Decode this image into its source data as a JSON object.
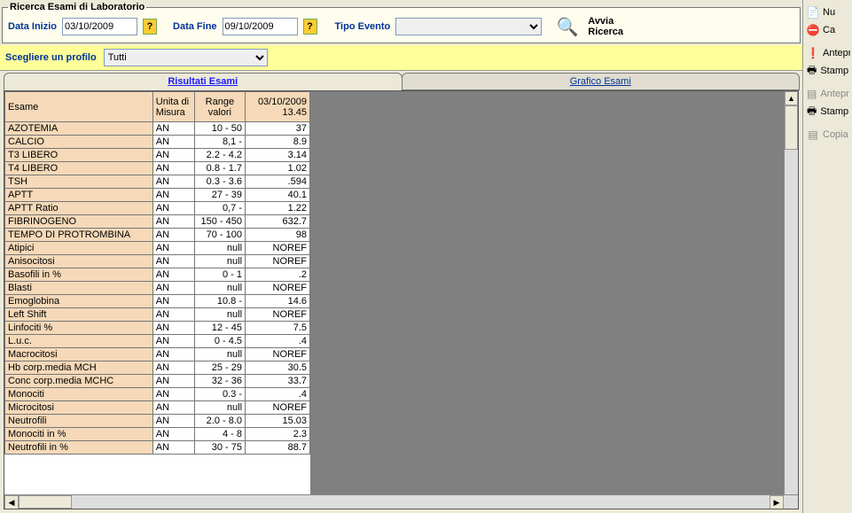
{
  "search": {
    "legend": "Ricerca Esami di Laboratorio",
    "data_inizio_label": "Data Inizio",
    "data_inizio_value": "03/10/2009",
    "help": "?",
    "data_fine_label": "Data Fine",
    "data_fine_value": "09/10/2009",
    "tipo_evento_label": "Tipo Evento",
    "tipo_evento_value": "",
    "avvia": "Avvia",
    "ricerca": "Ricerca"
  },
  "profile": {
    "label": "Scegliere un profilo",
    "value": "Tutti"
  },
  "tabs": {
    "risultati": "Risultati Esami",
    "grafico": "Grafico Esami"
  },
  "grid": {
    "headers": {
      "esame": "Esame",
      "unita": "Unita di\nMisura",
      "range": "Range\nvalori",
      "col1_date": "03/10/2009",
      "col1_time": "13.45"
    },
    "rows": [
      {
        "esame": "AZOTEMIA",
        "unita": "AN",
        "range": "10 - 50",
        "v": "37"
      },
      {
        "esame": "CALCIO",
        "unita": "AN",
        "range": "8,1 -",
        "v": "8.9"
      },
      {
        "esame": "T3 LIBERO",
        "unita": "AN",
        "range": "2.2 - 4.2",
        "v": "3.14"
      },
      {
        "esame": "T4 LIBERO",
        "unita": "AN",
        "range": "0.8 - 1.7",
        "v": "1.02"
      },
      {
        "esame": "TSH",
        "unita": "AN",
        "range": "0.3 - 3.6",
        "v": ".594"
      },
      {
        "esame": "APTT",
        "unita": "AN",
        "range": "27 - 39",
        "v": "40.1"
      },
      {
        "esame": "APTT Ratio",
        "unita": "AN",
        "range": "0,7 -",
        "v": "1.22"
      },
      {
        "esame": "FIBRINOGENO",
        "unita": "AN",
        "range": "150 - 450",
        "v": "632.7"
      },
      {
        "esame": "TEMPO DI PROTROMBINA",
        "unita": "AN",
        "range": "70 - 100",
        "v": "98"
      },
      {
        "esame": "Atipici",
        "unita": "AN",
        "range": "null",
        "v": "NOREF"
      },
      {
        "esame": "Anisocitosi",
        "unita": "AN",
        "range": "null",
        "v": "NOREF"
      },
      {
        "esame": "Basofili in %",
        "unita": "AN",
        "range": "0 - 1",
        "v": ".2"
      },
      {
        "esame": "Blasti",
        "unita": "AN",
        "range": "null",
        "v": "NOREF"
      },
      {
        "esame": "Emoglobina",
        "unita": "AN",
        "range": "10.8 -",
        "v": "14.6"
      },
      {
        "esame": "Left Shift",
        "unita": "AN",
        "range": "null",
        "v": "NOREF"
      },
      {
        "esame": "Linfociti %",
        "unita": "AN",
        "range": "12 - 45",
        "v": "7.5"
      },
      {
        "esame": "L.u.c.",
        "unita": "AN",
        "range": "0 - 4.5",
        "v": ".4"
      },
      {
        "esame": "Macrocitosi",
        "unita": "AN",
        "range": "null",
        "v": "NOREF"
      },
      {
        "esame": "Hb corp.media MCH",
        "unita": "AN",
        "range": "25 - 29",
        "v": "30.5"
      },
      {
        "esame": "Conc corp.media MCHC",
        "unita": "AN",
        "range": "32 - 36",
        "v": "33.7"
      },
      {
        "esame": "Monociti",
        "unita": "AN",
        "range": "0.3 -",
        "v": ".4"
      },
      {
        "esame": "Microcitosi",
        "unita": "AN",
        "range": "null",
        "v": "NOREF"
      },
      {
        "esame": "Neutrofili",
        "unita": "AN",
        "range": "2.0 - 8.0",
        "v": "15.03"
      },
      {
        "esame": "Monociti in %",
        "unita": "AN",
        "range": "4 - 8",
        "v": "2.3"
      },
      {
        "esame": "Neutrofili in %",
        "unita": "AN",
        "range": "30 - 75",
        "v": "88.7"
      }
    ]
  },
  "sidebar": {
    "items": [
      {
        "icon": "📄",
        "label": "Nu"
      },
      {
        "icon": "⛔",
        "label": "Ca"
      },
      {
        "icon": "❗",
        "label": "Antepr"
      },
      {
        "icon": "🖶",
        "label": "Stamp"
      },
      {
        "icon": "▤",
        "label": "Antepr",
        "disabled": true
      },
      {
        "icon": "🖶",
        "label": "Stamp",
        "disabled": false
      },
      {
        "icon": "▤",
        "label": "Copia",
        "disabled": true
      }
    ]
  }
}
